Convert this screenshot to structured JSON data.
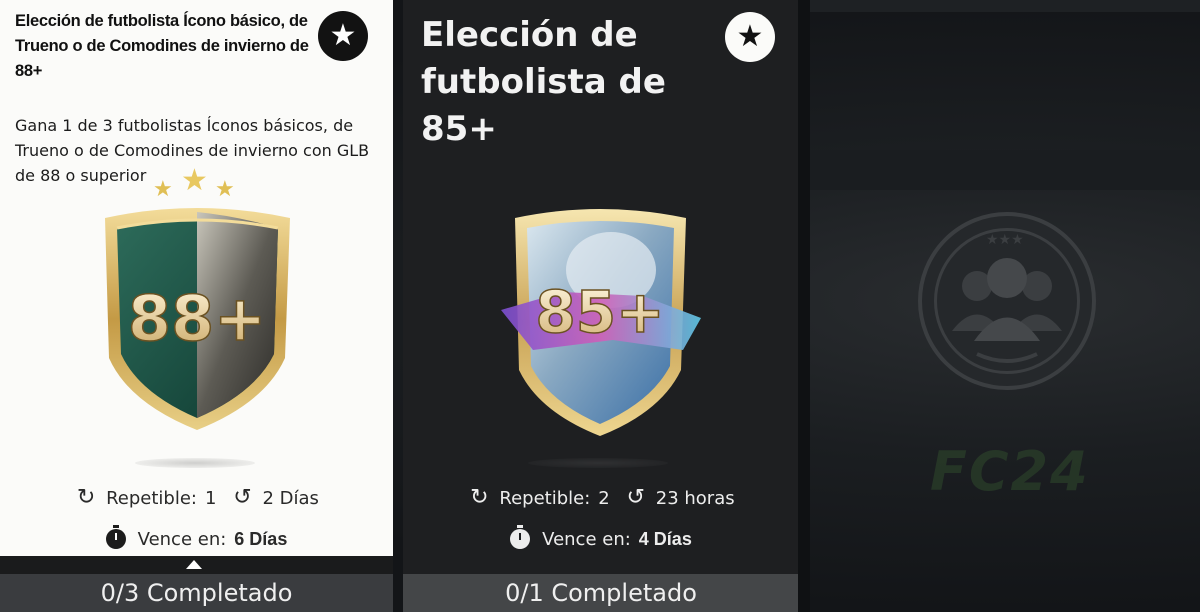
{
  "cards": [
    {
      "title": "Elección de futbolista Ícono básico, de Trueno o de Comodines de invierno de 88+",
      "description": "Gana 1 de 3 futbolistas Íconos básicos, de Trueno o de Comodines de invierno con GLB de 88 o superior",
      "badge_label": "88+",
      "repeatable_label": "Repetible:",
      "repeatable_value": "1",
      "time_value": "2 Días",
      "expires_label": "Vence en:",
      "expires_value": "6 Días",
      "progress": "0/3 Completado",
      "icons": [
        "star-icon",
        "repeat-icon",
        "history-icon",
        "stopwatch-icon",
        "caret-up-icon"
      ]
    },
    {
      "title": "Elección de futbolista de 85+",
      "badge_label": "85+",
      "repeatable_label": "Repetible:",
      "repeatable_value": "2",
      "time_value": "23 horas",
      "expires_label": "Vence en:",
      "expires_value": "4 Días",
      "progress": "0/1 Completado",
      "icons": [
        "star-icon",
        "repeat-icon",
        "history-icon",
        "stopwatch-icon"
      ]
    }
  ],
  "background": {
    "logo_text": "FC24"
  },
  "colors": {
    "card_light_bg": "#fbfbf9",
    "card_dark_bg": "#1e1f21",
    "gold": "#d8b766",
    "footer": "#3a3c3f"
  }
}
